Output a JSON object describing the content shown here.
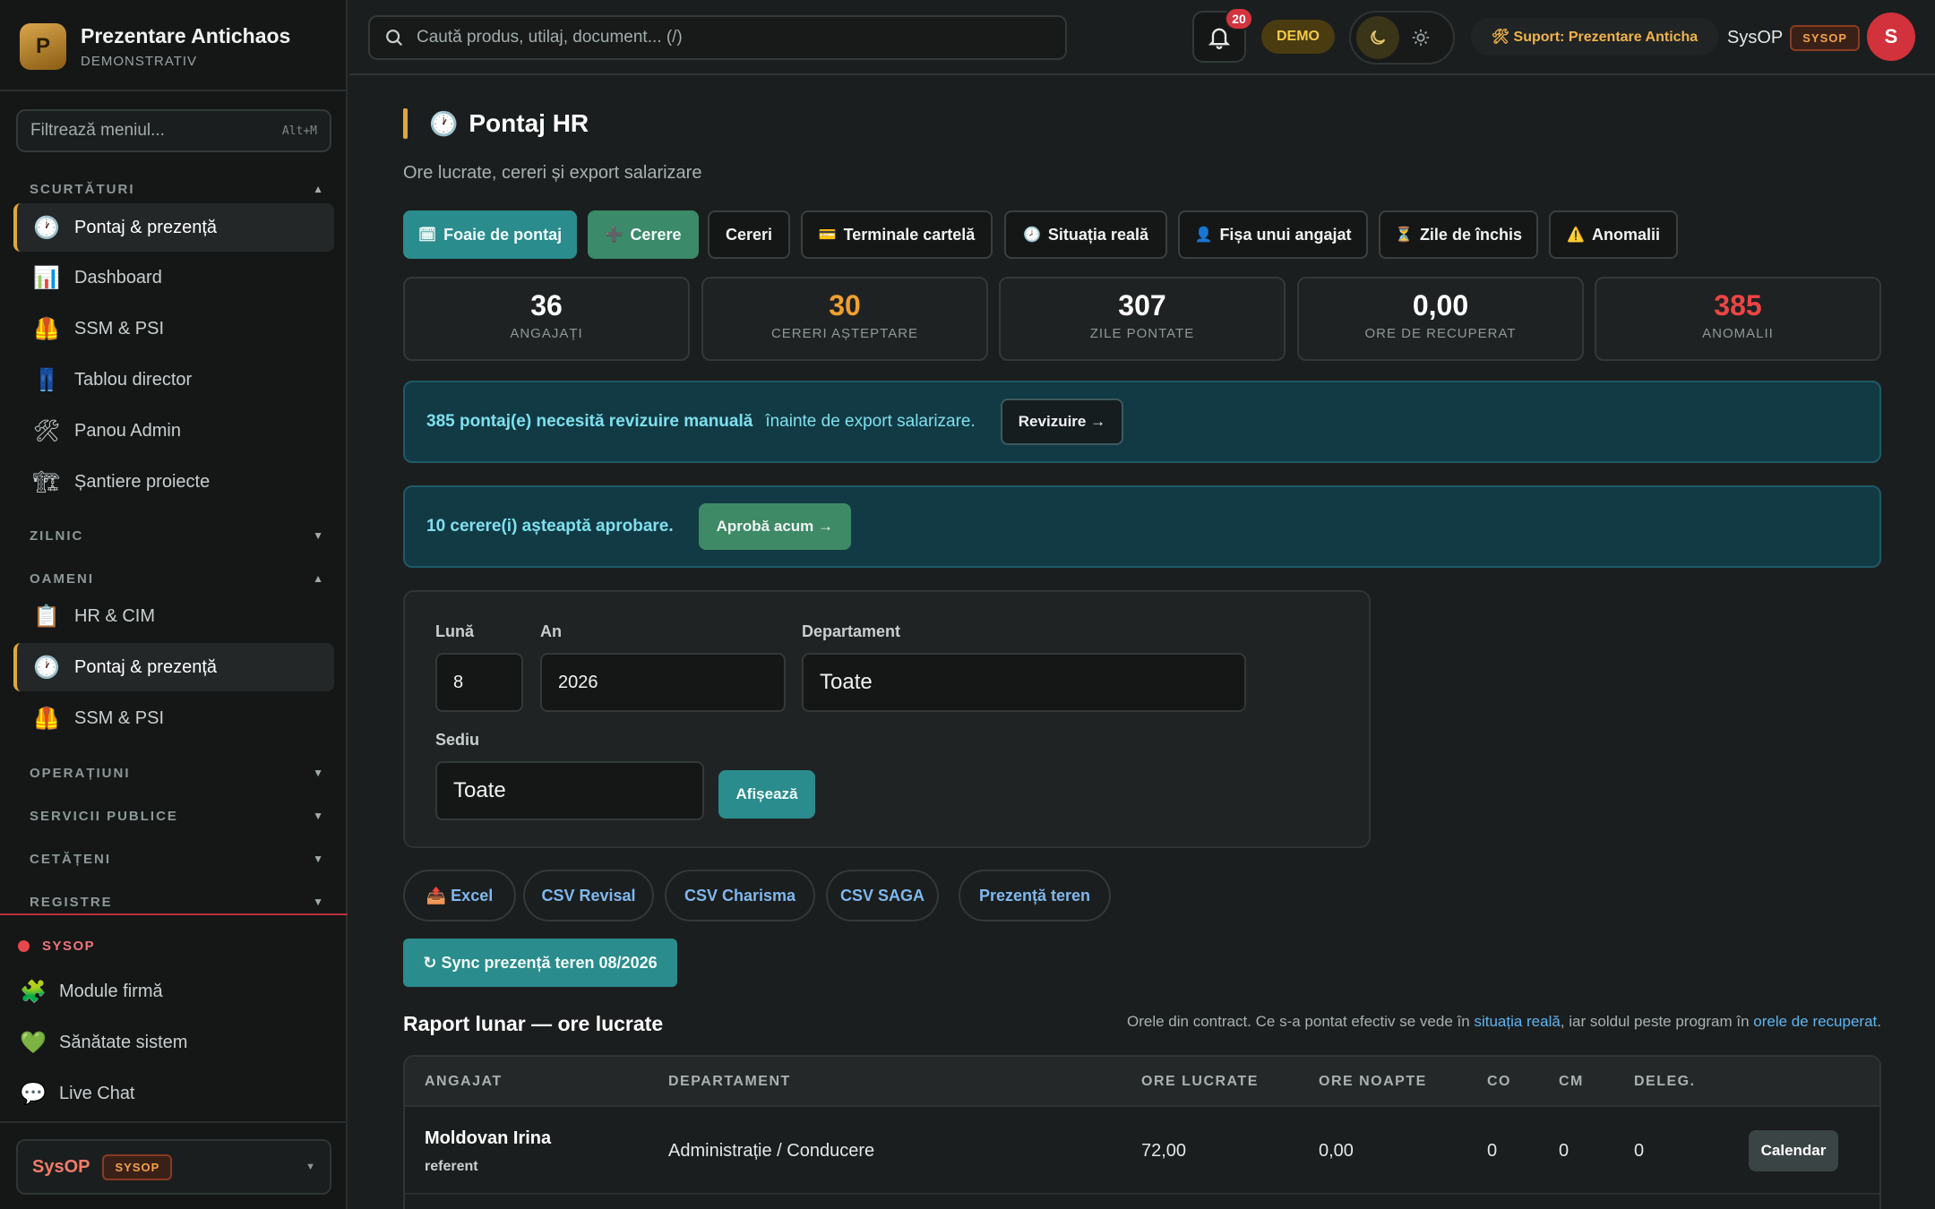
{
  "brand": {
    "initial": "P",
    "title": "Prezentare Antichaos",
    "subtitle": "DEMONSTRATIV"
  },
  "sidebar": {
    "filter_placeholder": "Filtrează meniul...",
    "filter_shortcut": "Alt+M",
    "sections": {
      "shortcuts": {
        "label": "SCURTĂTURI",
        "expanded": true
      },
      "daily": {
        "label": "ZILNIC",
        "expanded": false
      },
      "people": {
        "label": "OAMENI",
        "expanded": true
      },
      "operations": {
        "label": "OPERAȚIUNI",
        "expanded": false
      },
      "public_services": {
        "label": "SERVICII PUBLICE",
        "expanded": false
      },
      "citizens": {
        "label": "CETĂȚENI",
        "expanded": false
      },
      "registers": {
        "label": "REGISTRE",
        "expanded": false
      }
    },
    "shortcut_items": [
      {
        "label": "Pontaj & prezență",
        "icon": "clock-icon",
        "active": true
      },
      {
        "label": "Dashboard",
        "icon": "bar-chart-icon",
        "active": false
      },
      {
        "label": "SSM & PSI",
        "icon": "safety-vest-icon",
        "active": false
      },
      {
        "label": "Tablou director",
        "icon": "jeans-icon",
        "active": false
      },
      {
        "label": "Panou Admin",
        "icon": "tools-icon",
        "active": false
      },
      {
        "label": "Șantiere proiecte",
        "icon": "crane-icon",
        "active": false
      }
    ],
    "people_items": [
      {
        "label": "HR & CIM",
        "icon": "clipboard-icon",
        "active": false
      },
      {
        "label": "Pontaj & prezență",
        "icon": "clock-icon",
        "active": true
      },
      {
        "label": "SSM & PSI",
        "icon": "safety-vest-icon",
        "active": false
      }
    ],
    "sysop": {
      "label": "SYSOP",
      "items": [
        {
          "label": "Module firmă",
          "icon": "puzzle-icon"
        },
        {
          "label": "Sănătate sistem",
          "icon": "heart-icon"
        },
        {
          "label": "Live Chat",
          "icon": "chat-bubble-icon"
        }
      ]
    },
    "user": {
      "name": "SysOP",
      "role": "SYSOP"
    }
  },
  "topbar": {
    "search_placeholder": "Caută produs, utilaj, document... (/)",
    "notifications_count": "20",
    "demo_label": "DEMO",
    "support_label": "🛠 Suport: Prezentare Anticha",
    "user_name": "SysOP",
    "user_role": "SYSOP",
    "avatar_initial": "S",
    "theme": "dark"
  },
  "page": {
    "icon": "🕐",
    "title": "Pontaj HR",
    "subtitle": "Ore lucrate, cereri și export salarizare"
  },
  "tabs": [
    {
      "label": "Foaie de pontaj",
      "icon": "🗓",
      "style": "primary"
    },
    {
      "label": "Cerere",
      "icon": "➕",
      "style": "success"
    },
    {
      "label": "Cereri",
      "icon": "",
      "style": "default"
    },
    {
      "label": "Terminale cartelă",
      "icon": "💳",
      "style": "default"
    },
    {
      "label": "Situația reală",
      "icon": "🕗",
      "style": "default"
    },
    {
      "label": "Fișa unui angajat",
      "icon": "👤",
      "style": "default"
    },
    {
      "label": "Zile de închis",
      "icon": "⏳",
      "style": "default"
    },
    {
      "label": "Anomalii",
      "icon": "⚠️",
      "style": "default"
    }
  ],
  "stats": [
    {
      "value": "36",
      "label": "ANGAJAȚI",
      "color": "#ffffff"
    },
    {
      "value": "30",
      "label": "CERERI AȘTEPTARE",
      "color": "#f0a030"
    },
    {
      "value": "307",
      "label": "ZILE PONTATE",
      "color": "#ffffff"
    },
    {
      "value": "0,00",
      "label": "ORE DE RECUPERAT",
      "color": "#ffffff"
    },
    {
      "value": "385",
      "label": "ANOMALII",
      "color": "#ef4444"
    }
  ],
  "alerts": {
    "review": {
      "strong": "385 pontaj(e) necesită revizuire manuală",
      "text": "înainte de export salarizare.",
      "button": "Revizuire →"
    },
    "approval": {
      "strong": "10 cerere(i) așteaptă aprobare.",
      "button": "Aprobă acum →"
    }
  },
  "filters": {
    "month": {
      "label": "Lună",
      "value": "8"
    },
    "year": {
      "label": "An",
      "value": "2026"
    },
    "department": {
      "label": "Departament",
      "value": "Toate"
    },
    "site": {
      "label": "Sediu",
      "value": "Toate"
    },
    "show_button": "Afișează"
  },
  "exports": [
    {
      "label": "📤 Excel"
    },
    {
      "label": "CSV Revisal"
    },
    {
      "label": "CSV Charisma"
    },
    {
      "label": "CSV SAGA"
    },
    {
      "label": "Prezență teren"
    }
  ],
  "sync_button": "↻ Sync prezență teren 08/2026",
  "report": {
    "title": "Raport lunar — ore lucrate",
    "note_prefix": "Orele din contract. Ce s-a pontat efectiv se vede în ",
    "note_link1": "situația reală",
    "note_middle": ", iar soldul peste program în ",
    "note_link2": "orele de recuperat",
    "note_suffix": ".",
    "columns": [
      "ANGAJAT",
      "DEPARTAMENT",
      "ORE LUCRATE",
      "ORE NOAPTE",
      "CO",
      "CM",
      "DELEG."
    ],
    "rows": [
      {
        "name": "Moldovan Irina",
        "role": "referent",
        "department": "Administrație / Conducere",
        "hours": "72,00",
        "night": "0,00",
        "co": "0",
        "cm": "0",
        "deleg": "0",
        "action": "Calendar"
      }
    ]
  },
  "colors": {
    "accent": "#e3a63a",
    "primary": "#2a8c8c",
    "success": "#3b8a6a",
    "danger": "#ef4444",
    "warning": "#f0a030",
    "link": "#5fb4f0"
  }
}
